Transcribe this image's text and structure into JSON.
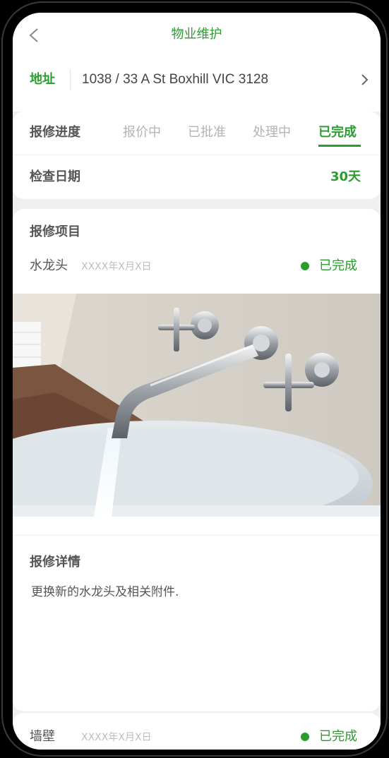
{
  "header": {
    "title": "物业维护",
    "back_icon": "chevron-left-icon"
  },
  "address": {
    "label": "地址",
    "value": "1038 / 33 A St Boxhill VIC 3128",
    "arrow_icon": "chevron-right-icon"
  },
  "progress": {
    "label": "报修进度",
    "stages": [
      "报价中",
      "已批准",
      "处理中",
      "已完成"
    ],
    "active_stage": "已完成"
  },
  "inspection": {
    "label": "检查日期",
    "value": "30天"
  },
  "repair_items": {
    "title": "报修项目",
    "items": [
      {
        "name": "水龙头",
        "date": "XXXX年X月X日",
        "status": "已完成"
      },
      {
        "name": "墙壁",
        "date": "XXXX年X月X日",
        "status": "已完成"
      }
    ]
  },
  "repair_details": {
    "title": "报修详情",
    "text": "更换新的水龙头及相关附件."
  },
  "colors": {
    "accent": "#2a9d2e",
    "muted": "#b3b3b3",
    "text": "#555555",
    "background": "#efefef"
  }
}
